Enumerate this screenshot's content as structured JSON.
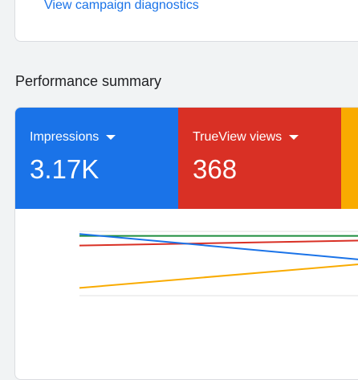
{
  "colors": {
    "link": "#1a73e8",
    "impressions": "#1a73e8",
    "trueview": "#d93025",
    "third_metric": "#f9ab00",
    "green_series": "#1e8e3e"
  },
  "diagnostics": {
    "link_label": "View campaign diagnostics"
  },
  "performance": {
    "title": "Performance summary",
    "metrics": [
      {
        "label": "Impressions",
        "value": "3.17K",
        "color": "#1a73e8",
        "icon": "caret-down-icon"
      },
      {
        "label": "TrueView views",
        "value": "368",
        "color": "#d93025",
        "icon": "caret-down-icon"
      },
      {
        "label": "",
        "value": "",
        "color": "#f9ab00"
      }
    ]
  },
  "chart_data": {
    "type": "line",
    "title": "",
    "xlabel": "",
    "ylabel": "",
    "grid": true,
    "series": [
      {
        "color": "#1e8e3e",
        "values": [
          0.93,
          0.93
        ]
      },
      {
        "color": "#d93025",
        "values": [
          0.78,
          0.86
        ]
      },
      {
        "color": "#1a73e8",
        "values": [
          0.96,
          0.55
        ]
      },
      {
        "color": "#f9ab00",
        "values": [
          0.12,
          0.5
        ]
      }
    ]
  }
}
